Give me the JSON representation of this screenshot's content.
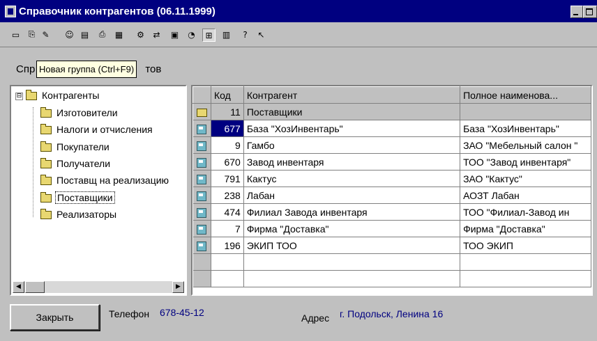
{
  "window": {
    "title": "Справочник контрагентов (06.11.1999)"
  },
  "toolbar": {
    "icons": [
      "new-icon",
      "copy-icon",
      "edit-icon",
      "user-icon",
      "doc-icon",
      "print-icon",
      "group-icon",
      "settings-icon",
      "move-icon",
      "open-icon",
      "history-icon",
      "tree-mode-icon",
      "hierarchy-icon",
      "help-icon",
      "pointer-help-icon"
    ]
  },
  "caption": {
    "prefix": "Спр",
    "suffix": "тов"
  },
  "tooltip": {
    "text": "Новая группа (Ctrl+F9)"
  },
  "tree": {
    "root": "Контрагенты",
    "items": [
      {
        "label": "Изготовители"
      },
      {
        "label": "Налоги и отчисления"
      },
      {
        "label": "Покупатели"
      },
      {
        "label": "Получатели"
      },
      {
        "label": "Поставщ на реализацию"
      },
      {
        "label": "Поставщики"
      },
      {
        "label": "Реализаторы"
      }
    ],
    "expander": "⊟"
  },
  "grid": {
    "columns": {
      "code": "Код",
      "contractor": "Контрагент",
      "fullname": "Полное наименова..."
    },
    "group_row": {
      "code": "11",
      "contractor": "Поставщики",
      "fullname": ""
    },
    "rows": [
      {
        "code": "677",
        "contractor": "База \"ХозИнвентарь\"",
        "fullname": "База \"ХозИнвентарь\""
      },
      {
        "code": "9",
        "contractor": "Гамбо",
        "fullname": "ЗАО \"Мебельный салон \""
      },
      {
        "code": "670",
        "contractor": "Завод инвентаря",
        "fullname": "ТОО \"Завод инвентаря\""
      },
      {
        "code": "791",
        "contractor": "Кактус",
        "fullname": "ЗАО \"Кактус\""
      },
      {
        "code": "238",
        "contractor": "Лабан",
        "fullname": "АОЗТ Лабан"
      },
      {
        "code": "474",
        "contractor": "Филиал Завода инвентаря",
        "fullname": "ТОО \"Филиал-Завод ин"
      },
      {
        "code": "7",
        "contractor": "Фирма \"Доставка\"",
        "fullname": "Фирма \"Доставка\""
      },
      {
        "code": "196",
        "contractor": "ЭКИП ТОО",
        "fullname": "ТОО ЭКИП"
      }
    ]
  },
  "footer": {
    "close_label": "Закрыть",
    "phone_label": "Телефон",
    "phone_value": "678-45-12",
    "address_label": "Адрес",
    "address_value": "г. Подольск, Ленина 16"
  },
  "colors": {
    "titlebar": "#000080",
    "selection": "#000080",
    "window": "#c0c0c0",
    "tooltip": "#ffffe1"
  }
}
